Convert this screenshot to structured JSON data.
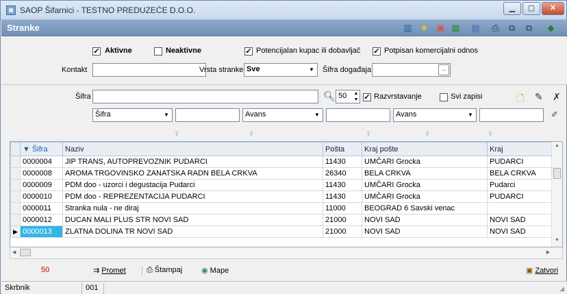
{
  "window": {
    "title": "SAOP Šifarnici - TESTNO PREDUZEĆE D.O.O.",
    "icon": "app-icon"
  },
  "header": {
    "title": "Stranke"
  },
  "filters": {
    "aktivne": {
      "label": "Aktivne",
      "checked": true
    },
    "neaktivne": {
      "label": "Neaktivne",
      "checked": false
    },
    "potencijalan": {
      "label": "Potencijalan kupac ili dobavljač",
      "checked": true
    },
    "potpisan": {
      "label": "Potpisan komercijalni odnos",
      "checked": true
    },
    "kontakt_label": "Kontakt",
    "kontakt_value": "",
    "vrsta_label": "Vrsta stranke",
    "vrsta_value": "Sve",
    "sifra_dogadjaja_label": "Šifra događaja",
    "sifra_dogadjaja_value": "",
    "dots": "..."
  },
  "search": {
    "sifra_label": "Šifra",
    "sifra_value": "",
    "count": "50",
    "razvrstavanje": {
      "label": "Razvrstavanje",
      "checked": true
    },
    "svi_zapisi": {
      "label": "Svi zapisi",
      "checked": false
    },
    "row2": {
      "col1": "Šifra",
      "op1": "Avans",
      "op2": "Avans"
    }
  },
  "table": {
    "columns": [
      "▼ Šifra",
      "Naziv",
      "Pošta",
      "Kraj pošte",
      "Kraj"
    ],
    "rows": [
      [
        "0000004",
        "JIP TRANS, AUTOPREVOZNIK  PUDARCI",
        "11430",
        "UMČARI Grocka",
        "PUDARCI"
      ],
      [
        "0000008",
        "AROMA TRGOVINSKO ZANATSKA RADN  BELA CRKVA",
        "26340",
        "BELA CRKVA",
        "BELA CRKVA"
      ],
      [
        "0000009",
        "PDM doo - uzorci i degustacija  Pudarci",
        "11430",
        "UMČARI Grocka",
        "Pudarci"
      ],
      [
        "0000010",
        "PDM doo - REPREZENTACIJA  PUDARCI",
        "11430",
        "UMČARI Grocka",
        "PUDARCI"
      ],
      [
        "0000011",
        "Stranka nula - ne diraj",
        "11000",
        "BEOGRAD 6 Savski venac",
        ""
      ],
      [
        "0000012",
        "DUCAN MALI PLUS STR  NOVI SAD",
        "21000",
        "NOVI SAD",
        "NOVI SAD"
      ],
      [
        "0000013",
        "ZLATNA DOLINA TR  NOVI SAD",
        "21000",
        "NOVI SAD",
        "NOVI SAD"
      ]
    ],
    "selected_index": 6
  },
  "bottom": {
    "count": "50",
    "promet": "Promet",
    "stampaj": "Štampaj",
    "mape": "Mape",
    "zatvori": "Zatvori"
  },
  "status": {
    "label": "Skrbnik",
    "value": "001"
  },
  "colors": {
    "header": "#7b99bf",
    "selected": "#33b5e5",
    "count_text": "#c00000"
  }
}
